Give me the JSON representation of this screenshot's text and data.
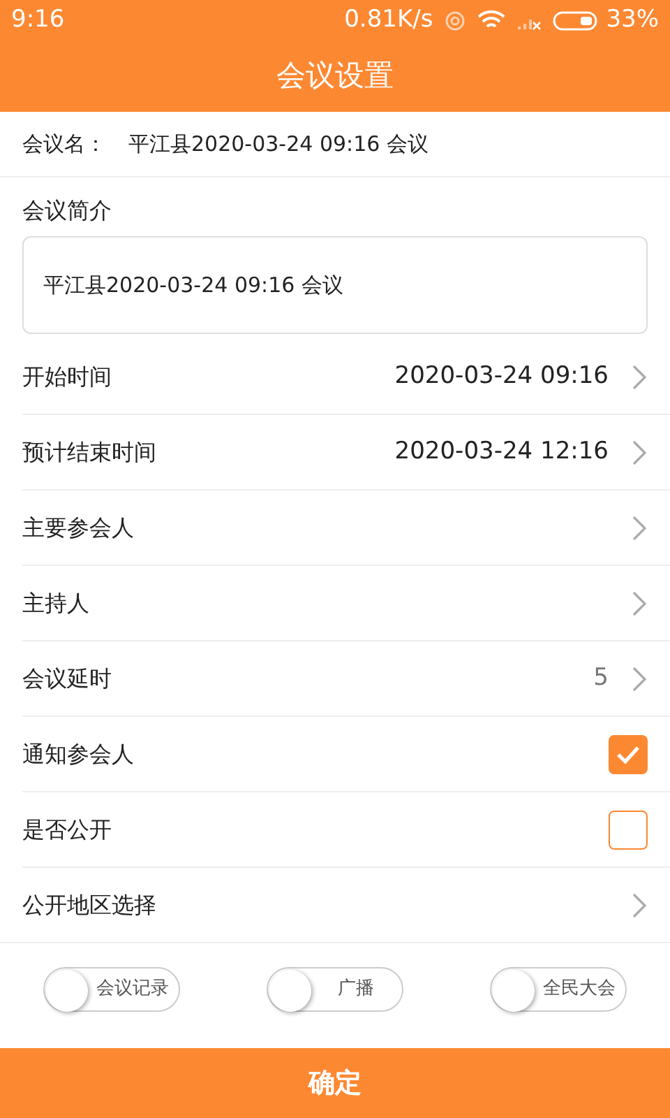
{
  "status_bar": {
    "time": "9:16",
    "speed": "0.81K/s",
    "battery": "33%"
  },
  "title": "会议设置",
  "meeting_name": {
    "label": "会议名：",
    "value": "平江县2020-03-24 09:16 会议"
  },
  "intro": {
    "label": "会议简介",
    "value": "平江县2020-03-24 09:16 会议"
  },
  "rows": [
    {
      "kind": "link",
      "label": "开始时间",
      "value": "2020-03-24 09:16"
    },
    {
      "kind": "link",
      "label": "预计结束时间",
      "value": "2020-03-24 12:16"
    },
    {
      "kind": "link",
      "label": "主要参会人"
    },
    {
      "kind": "link",
      "label": "主持人"
    },
    {
      "kind": "link",
      "label": "会议延时",
      "value": "5",
      "muted": true
    },
    {
      "kind": "check",
      "label": "通知参会人",
      "checked": true
    },
    {
      "kind": "check",
      "label": "是否公开",
      "checked": false
    },
    {
      "kind": "link",
      "label": "公开地区选择"
    }
  ],
  "toggles": [
    {
      "label": "会议记录",
      "on": false
    },
    {
      "label": "广播",
      "on": false
    },
    {
      "label": "全民大会",
      "on": false
    }
  ],
  "confirm_button": "确定"
}
